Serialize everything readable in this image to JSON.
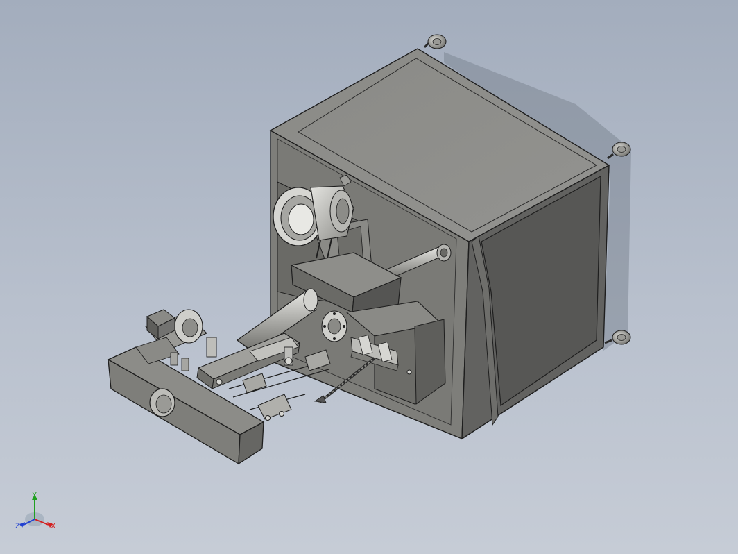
{
  "triad": {
    "x_label": "X",
    "y_label": "Y",
    "z_label": "Z",
    "x_color": "#d42020",
    "y_color": "#20a020",
    "z_color": "#2040d0"
  },
  "colors": {
    "cabinet_top": "#8f8f8a",
    "cabinet_front": "#7c7c78",
    "cabinet_side": "#5e5e5c",
    "panel_dark": "#555553",
    "metal_light": "#c8c8c4",
    "metal_mid": "#a4a4a0",
    "outline": "#1e1e1e"
  }
}
